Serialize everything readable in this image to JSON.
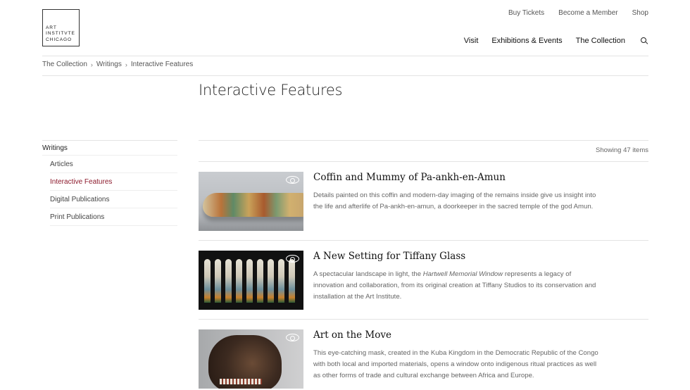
{
  "header": {
    "logo_text": "ART\nINSTITVTE\nCHICAGO",
    "utility_nav": [
      "Buy Tickets",
      "Become a Member",
      "Shop"
    ],
    "main_nav": [
      "Visit",
      "Exhibitions & Events",
      "The Collection"
    ],
    "search_icon": "search-icon"
  },
  "breadcrumb": [
    "The Collection",
    "Writings",
    "Interactive Features"
  ],
  "page_title": "Interactive Features",
  "sidebar": {
    "heading": "Writings",
    "items": [
      {
        "label": "Articles",
        "active": false
      },
      {
        "label": "Interactive Features",
        "active": true
      },
      {
        "label": "Digital Publications",
        "active": false
      },
      {
        "label": "Print Publications",
        "active": false
      }
    ]
  },
  "results": {
    "showing": "Showing 47 items",
    "items": [
      {
        "title": "Coffin and Mummy of Pa-ankh-en-Amun",
        "description": "Details painted on this coffin and modern-day imaging of the remains inside give us insight into the life and afterlife of Pa-ankh-en-amun, a doorkeeper in the sacred temple of the god Amun.",
        "icon": "eye-icon"
      },
      {
        "title": "A New Setting for Tiffany Glass",
        "description_pre": "A spectacular landscape in light, the ",
        "description_em": "Hartwell Memorial Window",
        "description_post": " represents a legacy of innovation and collaboration, from its original creation at Tiffany Studios to its conservation and installation at the Art Institute.",
        "icon": "eye-icon"
      },
      {
        "title": "Art on the Move",
        "description": "This eye-catching mask, created in the Kuba Kingdom in the Democratic Republic of the Congo with both local and imported materials, opens a window onto indigenous ritual practices as well as other forms of trade and cultural exchange between Africa and Europe.",
        "icon": "eye-icon"
      }
    ]
  },
  "colors": {
    "active_link": "#8c1a2c",
    "divider": "#e4e4e4"
  }
}
